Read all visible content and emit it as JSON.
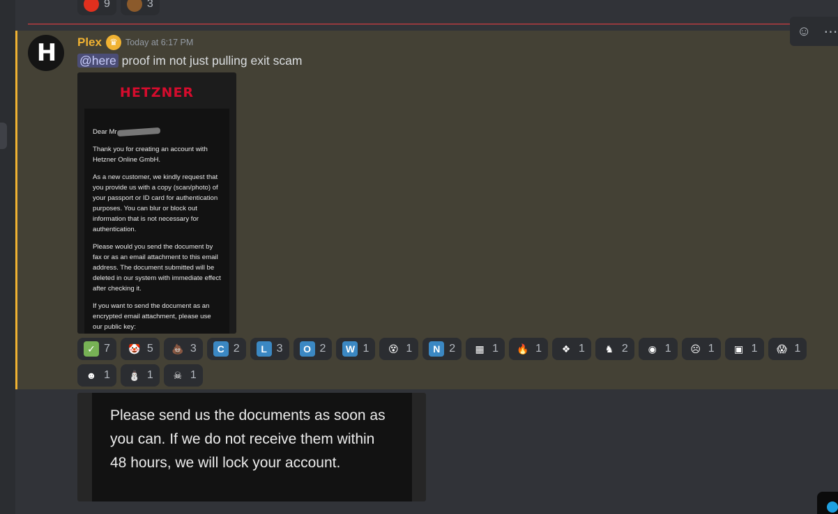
{
  "previous_reactions": [
    {
      "emoji": "red-face",
      "color": "#e0301e",
      "count": "9"
    },
    {
      "emoji": "poop",
      "color": "#8b5a2b",
      "count": "3"
    }
  ],
  "message": {
    "username": "Plex",
    "username_color": "#f0b232",
    "timestamp": "Today at 6:17 PM",
    "mention": "@here",
    "text": "proof im not just pulling exit scam"
  },
  "attachment1": {
    "logo": "HETZNER",
    "greeting": "Dear Mr",
    "paragraphs": [
      "Thank you for creating an account with Hetzner Online GmbH.",
      "As a new customer, we kindly request that you provide us with a copy (scan/photo) of your passport or ID card for authentication purposes. You can blur or block out information that is not necessary for authentication.",
      "Please would you send the document by fax or as an email attachment to this email address. The document submitted will be deleted in our system with immediate effect after checking it.",
      "If you want to send the document as an encrypted email attachment, please use our public key:"
    ]
  },
  "reactions": [
    {
      "emoji": "white-check-mark",
      "glyph": "✓",
      "style": "check",
      "count": "7"
    },
    {
      "emoji": "clown",
      "glyph": "🤡",
      "style": "plain",
      "count": "5"
    },
    {
      "emoji": "poop",
      "glyph": "💩",
      "style": "plain",
      "count": "3"
    },
    {
      "emoji": "regional-c",
      "glyph": "C",
      "style": "letter",
      "count": "2"
    },
    {
      "emoji": "regional-l",
      "glyph": "L",
      "style": "letter",
      "count": "3"
    },
    {
      "emoji": "regional-o",
      "glyph": "O",
      "style": "letter",
      "count": "2"
    },
    {
      "emoji": "regional-w",
      "glyph": "W",
      "style": "letter",
      "count": "1"
    },
    {
      "emoji": "yellow-face",
      "glyph": "😵",
      "style": "plain",
      "count": "1"
    },
    {
      "emoji": "regional-n",
      "glyph": "N",
      "style": "letter",
      "count": "2"
    },
    {
      "emoji": "custom-brown",
      "glyph": "▦",
      "style": "plain",
      "count": "1"
    },
    {
      "emoji": "fire-custom",
      "glyph": "🔥",
      "style": "plain",
      "count": "1"
    },
    {
      "emoji": "diamond-custom",
      "glyph": "❖",
      "style": "plain",
      "count": "1"
    },
    {
      "emoji": "figure-custom",
      "glyph": "♞",
      "style": "plain",
      "count": "2"
    },
    {
      "emoji": "amogus-custom",
      "glyph": "◉",
      "style": "plain",
      "count": "1"
    },
    {
      "emoji": "face-custom",
      "glyph": "☹",
      "style": "plain",
      "count": "1"
    },
    {
      "emoji": "photo-custom",
      "glyph": "▣",
      "style": "plain",
      "count": "1"
    },
    {
      "emoji": "scream",
      "glyph": "😱",
      "style": "plain",
      "count": "1"
    },
    {
      "emoji": "head-custom",
      "glyph": "☻",
      "style": "plain",
      "count": "1"
    },
    {
      "emoji": "ghost-custom",
      "glyph": "⛄",
      "style": "plain",
      "count": "1"
    },
    {
      "emoji": "skull-custom",
      "glyph": "☠",
      "style": "plain",
      "count": "1"
    }
  ],
  "attachment2": {
    "text": "Please send us the documents as soon as you can. If we do not receive them within 48 hours, we will lock your account."
  },
  "toolbar": {
    "icons": [
      "add-reaction-icon",
      "more-options-icon"
    ]
  }
}
